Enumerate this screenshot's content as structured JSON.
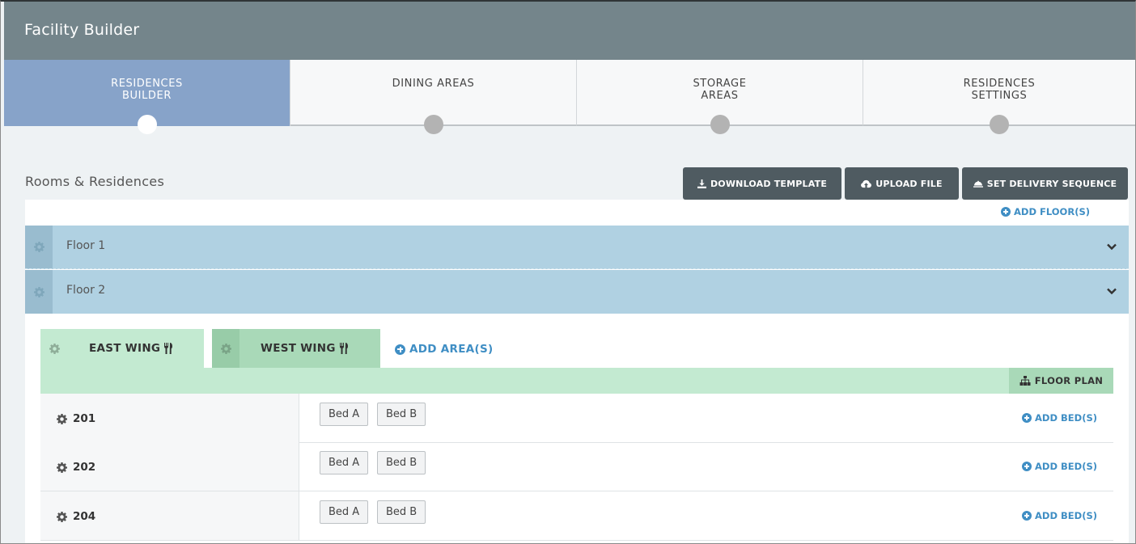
{
  "header": {
    "title": "Facility Builder"
  },
  "tabs": [
    {
      "label": "RESIDENCES\nBUILDER",
      "active": true
    },
    {
      "label": "DINING AREAS",
      "active": false
    },
    {
      "label": "STORAGE\nAREAS",
      "active": false
    },
    {
      "label": "RESIDENCES\nSETTINGS",
      "active": false
    }
  ],
  "section": {
    "title": "Rooms & Residences"
  },
  "actions": {
    "download_template": "DOWNLOAD TEMPLATE",
    "upload_file": "UPLOAD FILE",
    "set_delivery_sequence": "SET DELIVERY SEQUENCE"
  },
  "floors": {
    "add_label": "ADD FLOOR(S)",
    "items": [
      {
        "label": "Floor 1"
      },
      {
        "label": "Floor 2"
      }
    ]
  },
  "wings": {
    "items": [
      {
        "label": "EAST WING"
      },
      {
        "label": "WEST WING"
      }
    ],
    "add_label": "ADD AREA(S)",
    "floor_plan_label": "FLOOR PLAN"
  },
  "rooms": {
    "add_bed_label": "ADD BED(S)",
    "items": [
      {
        "number": "201",
        "beds": [
          "Bed A",
          "Bed B"
        ]
      },
      {
        "number": "202",
        "beds": [
          "Bed A",
          "Bed B"
        ]
      },
      {
        "number": "204",
        "beds": [
          "Bed A",
          "Bed B"
        ]
      }
    ]
  },
  "colors": {
    "header_bg": "#74858b",
    "active_tab": "#87a3c9",
    "floor_row": "#b0d1e2",
    "wing_green": "#c3ead1",
    "link_blue": "#3f8ec4",
    "dark_button": "#4f5b61"
  }
}
